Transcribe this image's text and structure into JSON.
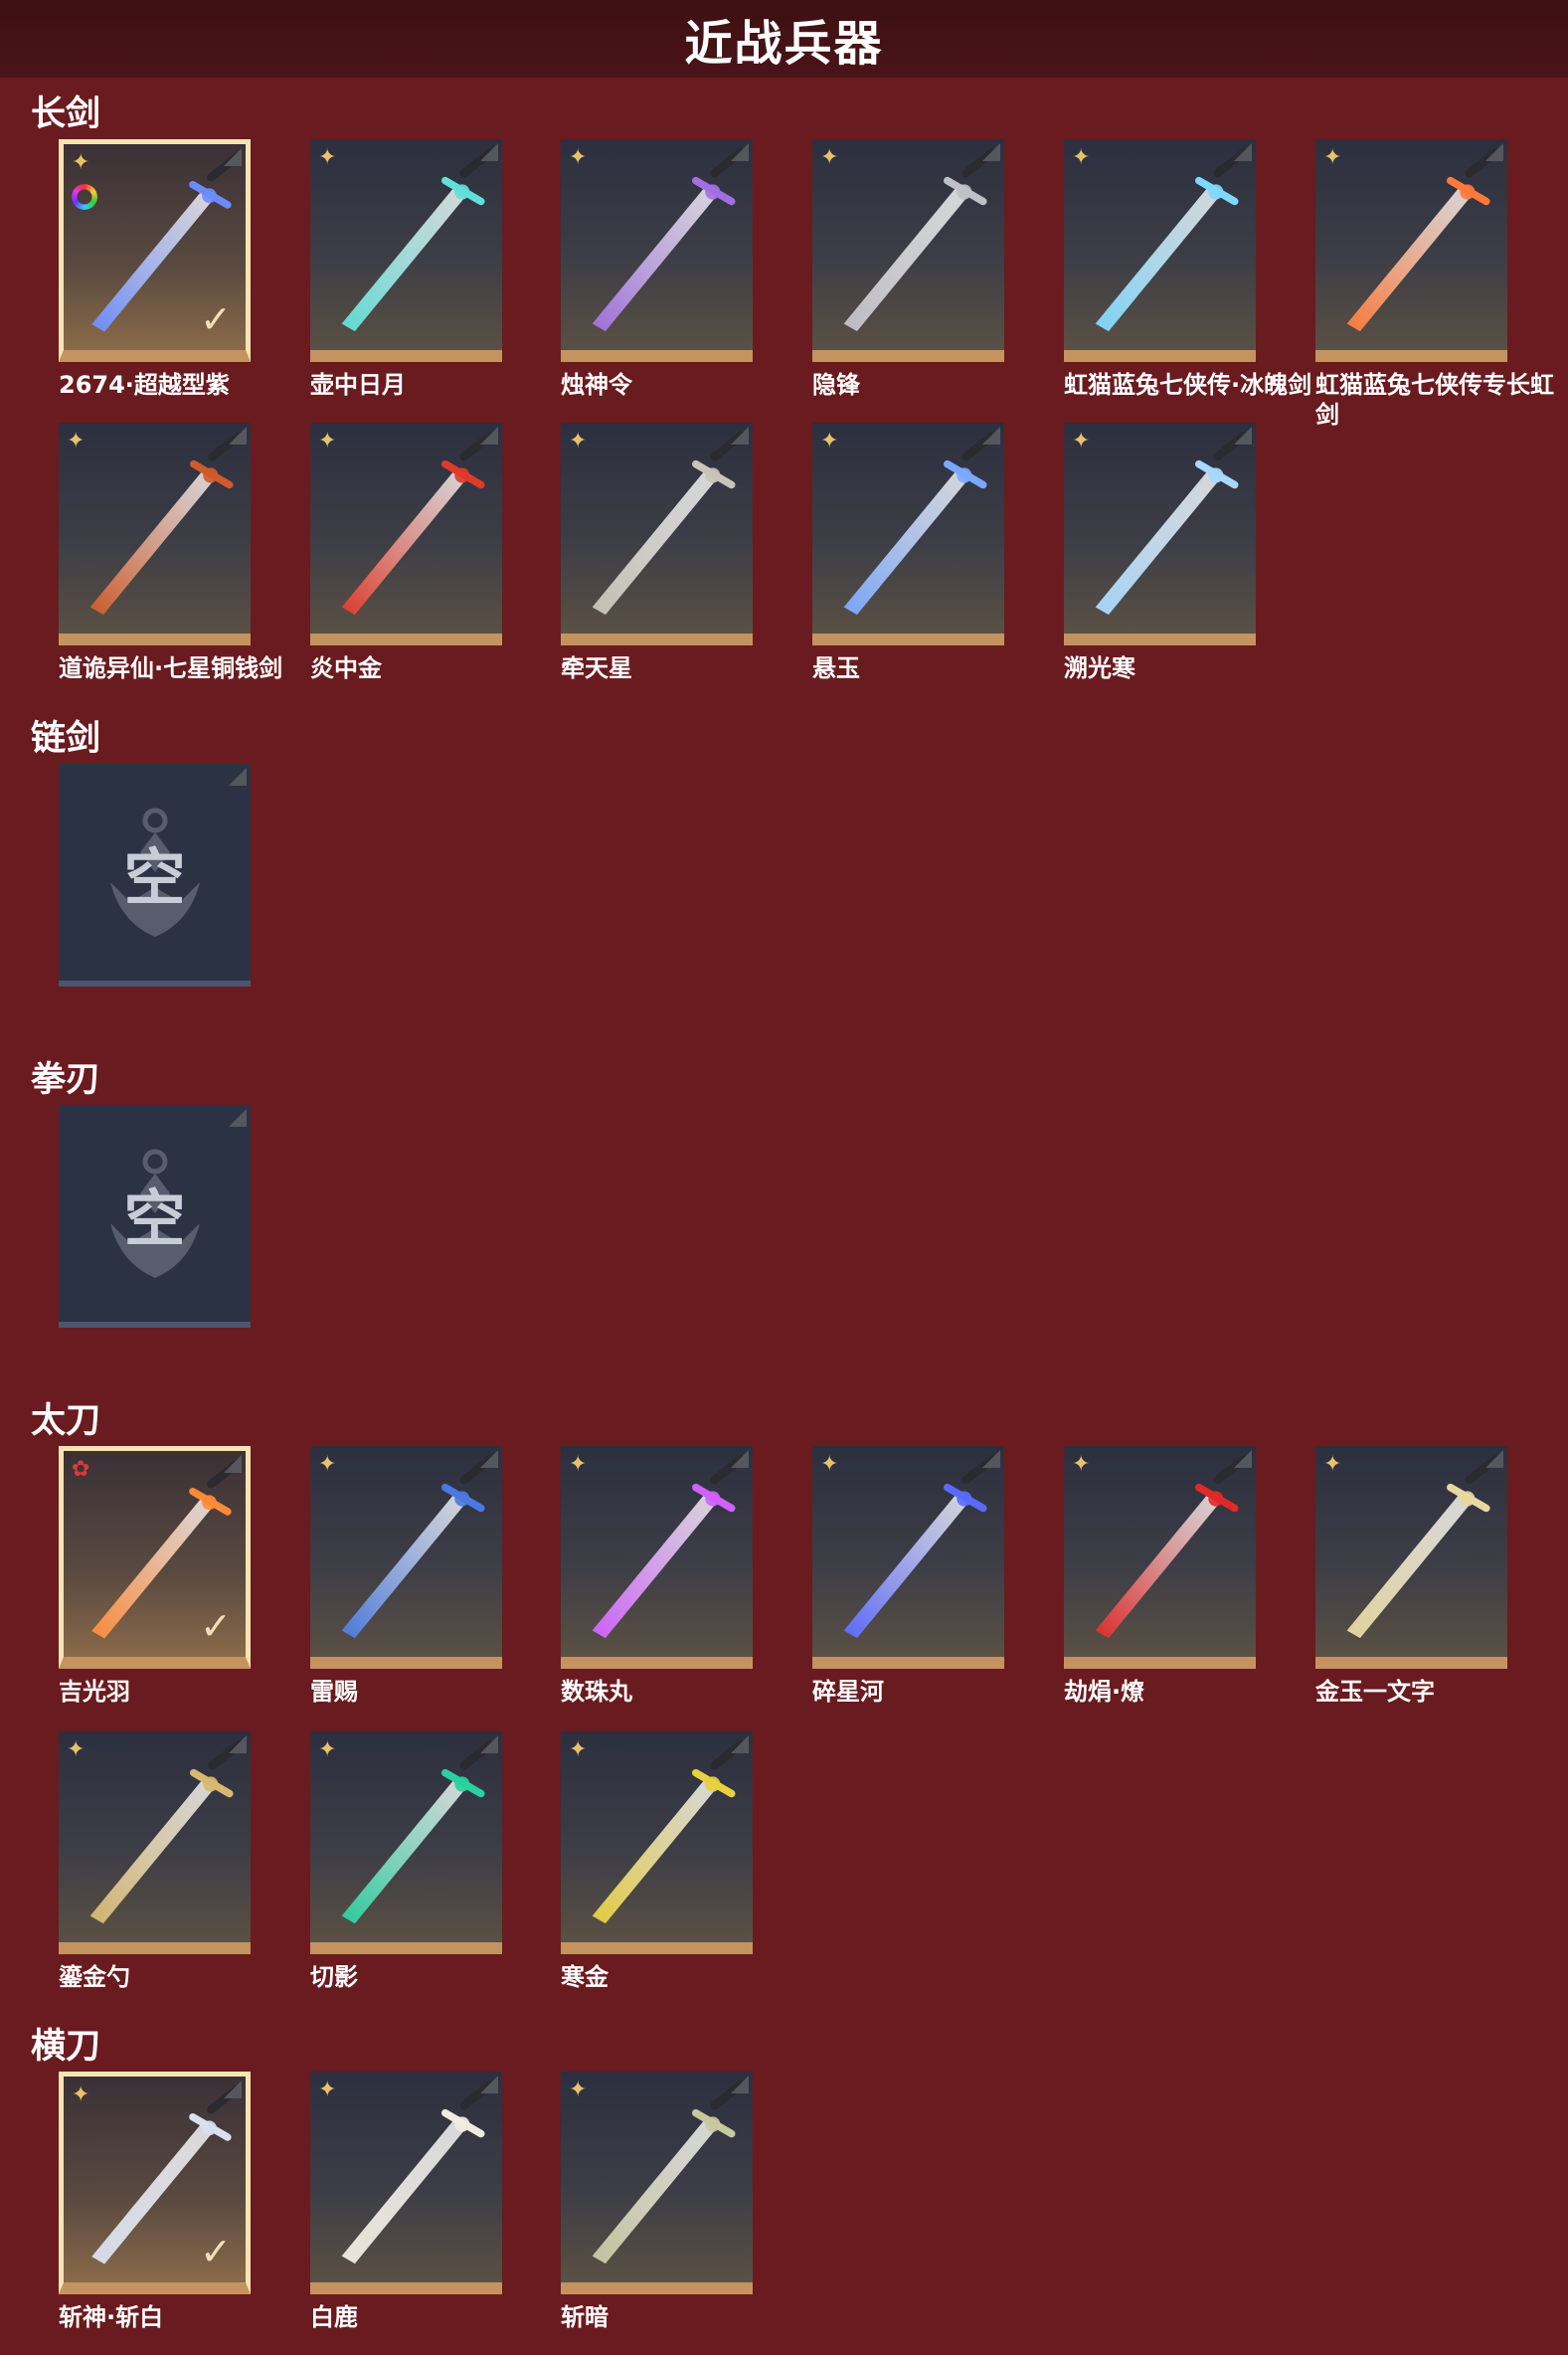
{
  "page": {
    "title": "近战兵器"
  },
  "icons": {
    "rarity": "gold-star-icon",
    "rarity_red": "red-star-icon",
    "equipped": "checkmark-icon",
    "dye": "rainbow-dye-icon"
  },
  "categories": [
    {
      "name": "长剑",
      "items": [
        {
          "name": "2674·超越型紫",
          "selected": true,
          "dye": true,
          "color": "#6a8cff"
        },
        {
          "name": "壶中日月",
          "color": "#5fe0d8"
        },
        {
          "name": "烛神令",
          "color": "#a070e0"
        },
        {
          "name": "隐锋",
          "color": "#c0c0c8"
        },
        {
          "name": "虹猫蓝兔七侠传·冰魄剑",
          "color": "#7fd8ff"
        },
        {
          "name": "虹猫蓝兔七侠传专长虹剑",
          "color": "#ff7a3a"
        },
        {
          "name": "道诡异仙·七星铜钱剑",
          "color": "#d05a2a"
        },
        {
          "name": "炎中金",
          "color": "#e03a2a"
        },
        {
          "name": "牵天星",
          "color": "#c8c4b8"
        },
        {
          "name": "悬玉",
          "color": "#7aa8ff"
        },
        {
          "name": "溯光寒",
          "color": "#a8d8ff"
        }
      ]
    },
    {
      "name": "链剑",
      "empty": true,
      "empty_text": "空"
    },
    {
      "name": "拳刃",
      "empty": true,
      "empty_text": "空"
    },
    {
      "name": "太刀",
      "items": [
        {
          "name": "吉光羽",
          "selected": true,
          "red": true,
          "color": "#ff8a3a"
        },
        {
          "name": "雷赐",
          "color": "#4a7ae0"
        },
        {
          "name": "数珠丸",
          "color": "#d060ff"
        },
        {
          "name": "碎星河",
          "color": "#5a6aff"
        },
        {
          "name": "劫焆·燎",
          "color": "#e02a2a"
        },
        {
          "name": "金玉一文字",
          "color": "#e8d8a0"
        },
        {
          "name": "鎏金勺",
          "color": "#d8b870"
        },
        {
          "name": "切影",
          "color": "#2ad0a0"
        },
        {
          "name": "寒金",
          "color": "#e8d040"
        }
      ]
    },
    {
      "name": "横刀",
      "items": [
        {
          "name": "斩神·斩白",
          "selected": true,
          "color": "#d8e0f0"
        },
        {
          "name": "白鹿",
          "color": "#f0ece0"
        },
        {
          "name": "斩暗",
          "color": "#c8c8a0"
        }
      ]
    }
  ]
}
